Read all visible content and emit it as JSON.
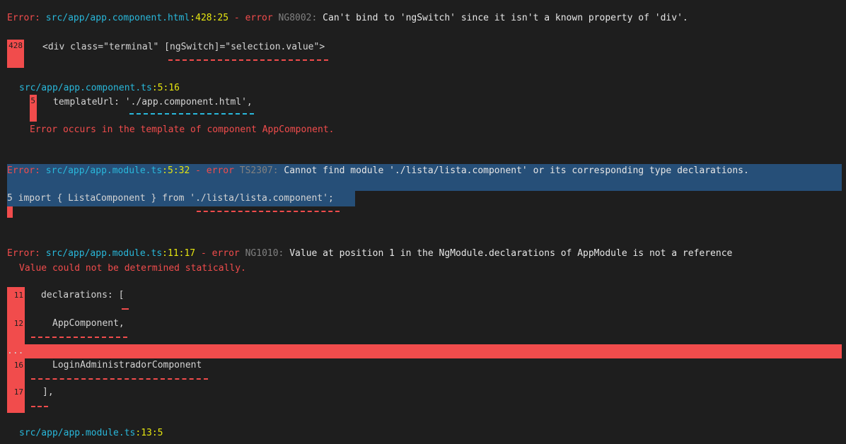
{
  "errors": [
    {
      "prefix": "Error:",
      "file": "src/app/app.component.html",
      "loc": ":428:25",
      "sep": " - error ",
      "code": "NG8002:",
      "message": " Can't bind to 'ngSwitch' since it isn't a known property of 'div'.",
      "snippet_line_no": "428",
      "snippet": "<div class=\"terminal\" [ngSwitch]=\"selection.value\">",
      "related_file": "src/app/app.component.ts",
      "related_loc": ":5:16",
      "related_line_no": "5",
      "related_snippet": "templateUrl: './app.component.html',",
      "note": "Error occurs in the template of component AppComponent."
    },
    {
      "prefix": "Error:",
      "file": "src/app/app.module.ts",
      "loc": ":5:32",
      "sep": " - error ",
      "code": "TS2307:",
      "message": " Cannot find module './lista/lista.component' or its corresponding type declarations.",
      "snippet_line_no": "5",
      "snippet": "import { ListaComponent } from './lista/lista.component';"
    },
    {
      "prefix": "Error:",
      "file": "src/app/app.module.ts",
      "loc": ":11:17",
      "sep": " - error ",
      "code": "NG1010:",
      "message": " Value at position 1 in the NgModule.declarations of AppModule is not a reference",
      "note": "Value could not be determined statically.",
      "lines": [
        {
          "no": "11",
          "text": "declarations: ["
        },
        {
          "no": "12",
          "text": "AppComponent,"
        },
        {
          "no": "16",
          "text": "LoginAdministradorComponent"
        },
        {
          "no": "17",
          "text": "],"
        }
      ],
      "ellipsis": "...",
      "related_file": "src/app/app.module.ts",
      "related_loc": ":13:5"
    }
  ],
  "colors": {
    "background": "#1e1e1e",
    "error_red": "#f14c4c",
    "path_cyan": "#29b8db",
    "loc_yellow": "#e5e510",
    "selection_blue": "#264f78"
  }
}
